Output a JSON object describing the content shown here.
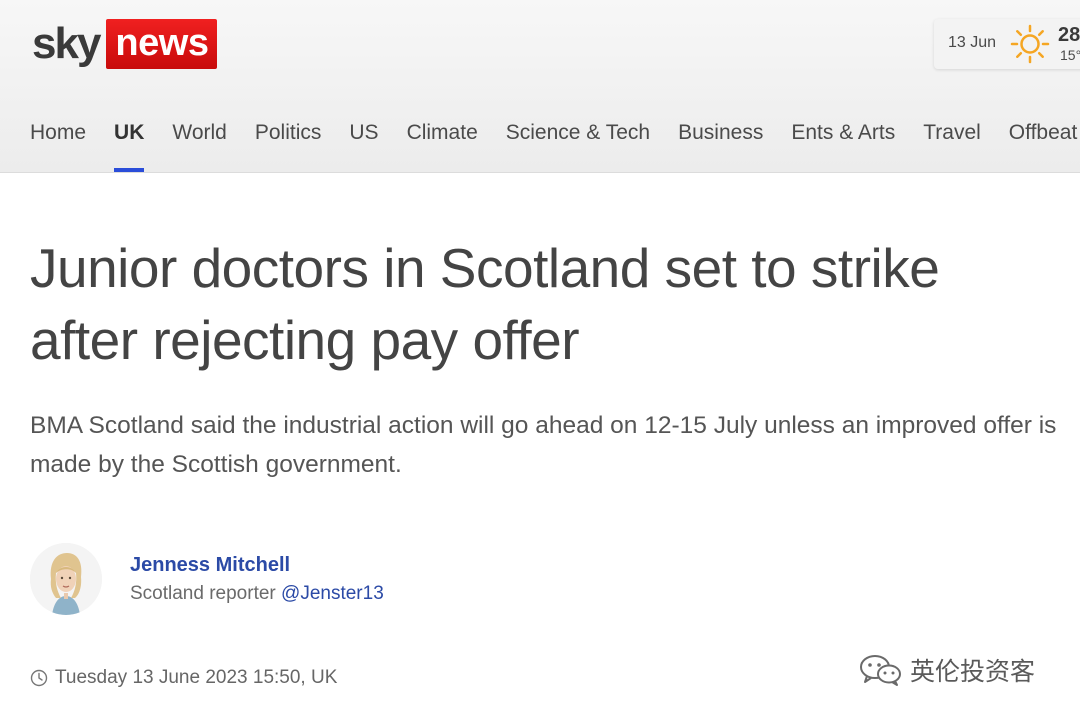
{
  "brand": {
    "sky": "sky",
    "news": "news",
    "red": "#e10f0f",
    "accent_blue": "#2a4dd9"
  },
  "weather": {
    "date": "13 Jun",
    "high": "28",
    "low": "15°",
    "icon": "sun-icon"
  },
  "nav": {
    "items": [
      {
        "label": "Home"
      },
      {
        "label": "UK",
        "active": true
      },
      {
        "label": "World"
      },
      {
        "label": "Politics"
      },
      {
        "label": "US"
      },
      {
        "label": "Climate"
      },
      {
        "label": "Science & Tech"
      },
      {
        "label": "Business"
      },
      {
        "label": "Ents & Arts"
      },
      {
        "label": "Travel"
      },
      {
        "label": "Offbeat"
      }
    ]
  },
  "article": {
    "headline": "Junior doctors in Scotland set to strike after rejecting pay offer",
    "standfirst": "BMA Scotland said the industrial action will go ahead on 12-15 July unless an improved offer is made by the Scottish government.",
    "author": {
      "name": "Jenness Mitchell",
      "role": "Scotland reporter",
      "handle": "@Jenster13"
    },
    "timestamp": "Tuesday 13 June 2023 15:50, UK"
  },
  "watermark": {
    "text": "英伦投资客",
    "icon": "wechat-icon"
  }
}
